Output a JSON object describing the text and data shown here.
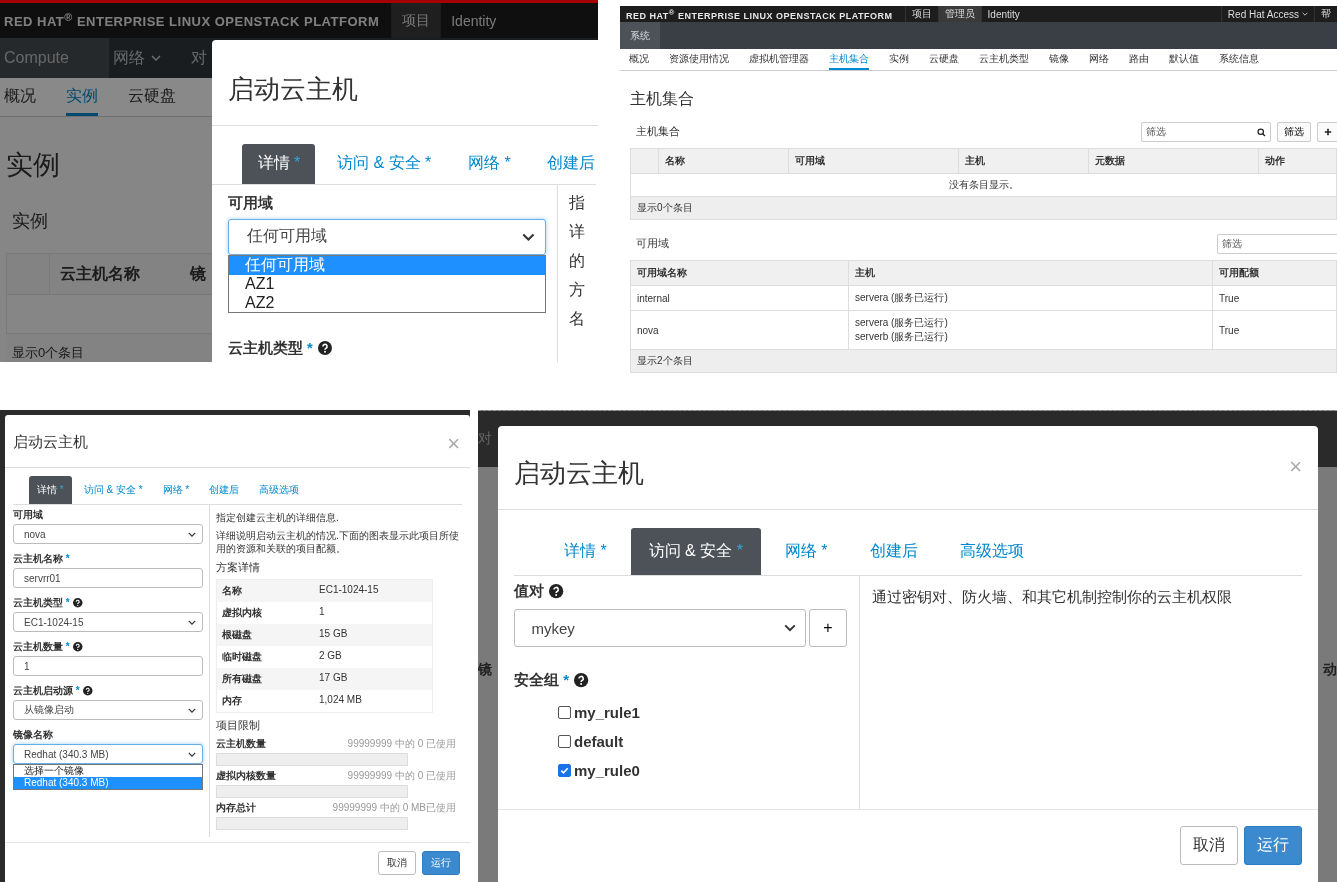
{
  "instances_screen": {
    "brand": "RED HAT$^{®}$ ENTERPRISE LINUX OPENSTACK PLATFORM",
    "top_nav": [
      {
        "label": "项目",
        "selected": true
      },
      {
        "label": "Identity",
        "selected": false
      }
    ],
    "dashboard_tabs": [
      {
        "label": "Compute",
        "selected": true,
        "dropdown": false
      },
      {
        "label": "网络",
        "selected": false,
        "dropdown": true
      },
      {
        "label": "对",
        "selected": false,
        "dropdown": false
      }
    ],
    "sub_nav": [
      {
        "label": "概况",
        "selected": false
      },
      {
        "label": "实例",
        "selected": true
      },
      {
        "label": "云硬盘",
        "selected": false
      }
    ],
    "page_title": "实例",
    "section_title": "实例",
    "table_columns": [
      "云主机名称",
      "镜"
    ],
    "table_footer": "显示0个条目",
    "dialog": {
      "title": "启动云主机",
      "tabs": [
        {
          "label": "详情",
          "marker": "*",
          "selected": true
        },
        {
          "label": "访问 & 安全",
          "marker": "*",
          "selected": false
        },
        {
          "label": "网络",
          "marker": "*",
          "selected": false
        },
        {
          "label": "创建后",
          "selected": false
        }
      ],
      "field_label": "可用域",
      "select_value": "任何可用域",
      "options": [
        {
          "label": "任何可用域",
          "selected": true
        },
        {
          "label": "AZ1",
          "selected": false
        },
        {
          "label": "AZ2",
          "selected": false
        }
      ],
      "next_label": {
        "label": "云主机类型",
        "marker": "*",
        "help": true
      },
      "side_fragments": [
        "指",
        "详",
        "的",
        "方",
        "名"
      ]
    }
  },
  "aggregates_screen": {
    "brand": "RED HAT$^{®}$ ENTERPRISE LINUX OPENSTACK PLATFORM",
    "top_nav": [
      {
        "label": "项目",
        "selected": false
      },
      {
        "label": "管理员",
        "selected": true
      },
      {
        "label": "Identity",
        "selected": false
      }
    ],
    "user_menu": "Red Hat Access",
    "cut_menu": "帮",
    "panel_tabs": [
      {
        "label": "系统",
        "selected": true
      }
    ],
    "sub_nav": [
      {
        "label": "概况",
        "selected": false
      },
      {
        "label": "资源使用情况",
        "selected": false
      },
      {
        "label": "虚拟机管理器",
        "selected": false
      },
      {
        "label": "主机集合",
        "selected": true
      },
      {
        "label": "实例",
        "selected": false
      },
      {
        "label": "云硬盘",
        "selected": false
      },
      {
        "label": "云主机类型",
        "selected": false
      },
      {
        "label": "镜像",
        "selected": false
      },
      {
        "label": "网络",
        "selected": false
      },
      {
        "label": "路由",
        "selected": false
      },
      {
        "label": "默认值",
        "selected": false
      },
      {
        "label": "系统信息",
        "selected": false
      }
    ],
    "page_title": "主机集合",
    "aggregates": {
      "title": "主机集合",
      "filter_placeholder": "筛选",
      "filter_button": "筛选",
      "columns": [
        "名称",
        "可用域",
        "主机",
        "元数据",
        "动作"
      ],
      "empty_message": "没有条目显示。",
      "footer": "显示0个条目"
    },
    "zones": {
      "title": "可用域",
      "filter_placeholder": "筛选",
      "columns": [
        "可用域名称",
        "主机",
        "可用配额"
      ],
      "rows": [
        {
          "name": "internal",
          "hosts": [
            "servera (服务已运行)"
          ],
          "quota": "True"
        },
        {
          "name": "nova",
          "hosts": [
            "servera (服务已运行)",
            "serverb (服务已运行)"
          ],
          "quota": "True"
        }
      ],
      "footer": "显示2个条目"
    }
  },
  "details_dialog": {
    "title": "启动云主机",
    "close": "×",
    "tabs": [
      {
        "label": "详情",
        "marker": "*",
        "selected": true
      },
      {
        "label": "访问 & 安全",
        "marker": "*",
        "selected": false
      },
      {
        "label": "网络",
        "marker": "*",
        "selected": false
      },
      {
        "label": "创建后",
        "selected": false
      },
      {
        "label": "高级选项",
        "selected": false
      }
    ],
    "fields": [
      {
        "kind": "select",
        "label": "可用域",
        "value": "nova"
      },
      {
        "kind": "input",
        "label": "云主机名称",
        "marker": "*",
        "value": "servrr01"
      },
      {
        "kind": "select",
        "label": "云主机类型",
        "marker": "*",
        "help": true,
        "value": "EC1-1024-15"
      },
      {
        "kind": "input",
        "label": "云主机数量",
        "marker": "*",
        "help": true,
        "value": "1"
      },
      {
        "kind": "select",
        "label": "云主机启动源",
        "marker": "*",
        "help": true,
        "value": "从镜像启动"
      },
      {
        "kind": "select",
        "label": "镜像名称",
        "value": "Redhat (340.3 MB)",
        "focused": true,
        "options": [
          {
            "label": "选择一个镜像",
            "selected": false
          },
          {
            "label": "Redhat (340.3 MB)",
            "selected": true
          }
        ]
      }
    ],
    "lead": "指定创建云主机的详细信息.",
    "description": "详细说明启动云主机的情况.下面的图表显示此项目所使用的资源和关联的项目配额。",
    "flavor_title": "方案详情",
    "flavor_rows": [
      {
        "name": "名称",
        "value": "EC1-1024-15"
      },
      {
        "name": "虚拟内核",
        "value": "1"
      },
      {
        "name": "根磁盘",
        "value": "15 GB"
      },
      {
        "name": "临时磁盘",
        "value": "2 GB"
      },
      {
        "name": "所有磁盘",
        "value": "17 GB"
      },
      {
        "name": "内存",
        "value": "1,024 MB"
      }
    ],
    "limits_title": "项目限制",
    "limits": [
      {
        "label": "云主机数量",
        "reading": "99999999 中的 0 已使用",
        "level": 0
      },
      {
        "label": "虚拟内核数量",
        "reading": "99999999 中的 0 已使用",
        "level": 0
      },
      {
        "label": "内存总计",
        "reading": "99999999 中的 0 MB已使用",
        "level": 0
      }
    ],
    "buttons": [
      {
        "label": "取消",
        "kind": "default"
      },
      {
        "label": "运行",
        "kind": "primary"
      }
    ]
  },
  "access_dialog": {
    "backdrop": {
      "top_left": "对",
      "left": "镜",
      "right": "动"
    },
    "title": "启动云主机",
    "close": "×",
    "tabs": [
      {
        "label": "详情",
        "marker": "*",
        "selected": false
      },
      {
        "label": "访问 & 安全",
        "marker": "*",
        "selected": true
      },
      {
        "label": "网络",
        "marker": "*",
        "selected": false
      },
      {
        "label": "创建后",
        "selected": false
      },
      {
        "label": "高级选项",
        "selected": false
      }
    ],
    "keypair": {
      "label": "值对",
      "help": true,
      "value": "mykey",
      "add_button": "+"
    },
    "security_groups": {
      "label": "安全组",
      "marker": "*",
      "help": true,
      "items": [
        {
          "label": "my_rule1",
          "checked": false
        },
        {
          "label": "default",
          "checked": false
        },
        {
          "label": "my_rule0",
          "checked": true
        }
      ]
    },
    "description": "通过密钥对、防火墙、和其它机制控制你的云主机权限",
    "buttons": [
      {
        "label": "取消",
        "kind": "default"
      },
      {
        "label": "运行",
        "kind": "primary"
      }
    ]
  }
}
